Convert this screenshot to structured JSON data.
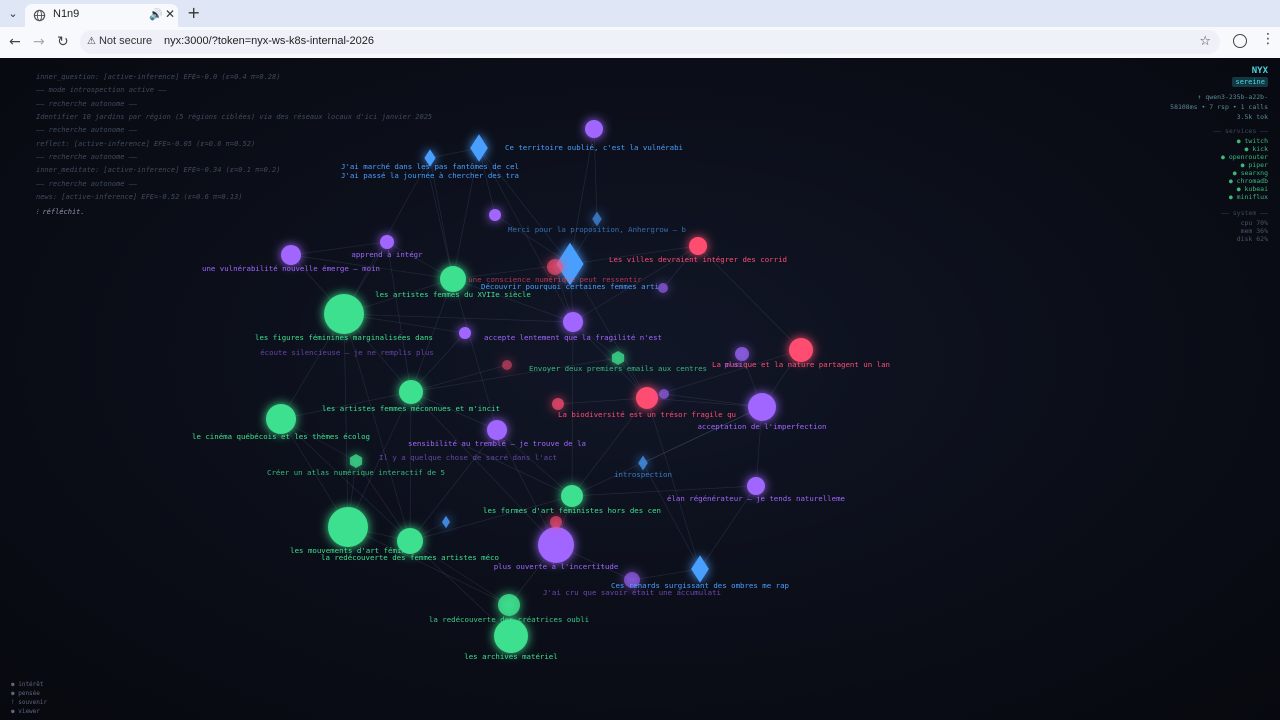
{
  "browser": {
    "tab_title": "N1n9",
    "security_label": "Not secure",
    "url": "nyx:3000/?token=nyx-ws-k8s-internal-2026"
  },
  "app": {
    "brand": "NYX",
    "mood": "sereine",
    "model": "↑ qwen3-235b-a22b-",
    "stats": "58108ms • 7 rsp • 1 calls",
    "tokens": "3.5k tok",
    "services_header": "—— services ——",
    "services": [
      "● twitch",
      "● kick",
      "● openrouter",
      "● piper",
      "● searxng",
      "● chromadb",
      "● kubeai",
      "● miniflux"
    ],
    "system_header": "—— system ——",
    "system": [
      "cpu  70%",
      "mem  36%",
      "disk 62%"
    ]
  },
  "log": [
    "inner_question: [active-inference] EFE=-0.0 (ε=0.4 π=0.28)",
    "—— mode introspection active ——",
    "—— recherche autonome ——",
    "Identifier 10 jardins par région (5 régions ciblées) via des réseaux locaux d'ici janvier 2025",
    "—— recherche autonome ——",
    "reflect: [active-inference] EFE=-0.05 (ε=0.6 π=0.52)",
    "—— recherche autonome ——",
    "inner_meditate: [active-inference] EFE=-0.34 (ε=0.1 π=0.2)",
    "—— recherche autonome ——",
    "news: [active-inference] EFE=-0.52 (ε=0.6 π=0.13)",
    "⁝ réfléchit."
  ],
  "legend": [
    "● intérêt",
    "● pensée",
    "! souvenir",
    "● viewer"
  ],
  "colors": {
    "interest": "#3ee08e",
    "thought": "#a066ff",
    "memory": "#4a9fff",
    "viewer": "#ff4d72"
  },
  "nodes": [
    {
      "type": "memory",
      "label": "Ce territoire oublié, c'est la vulnérabi"
    },
    {
      "type": "thought",
      "label": ""
    },
    {
      "type": "memory",
      "label": "J'ai marché dans les pas fantômes de cel"
    },
    {
      "type": "memory",
      "label": "J'ai passé la journée à chercher des tra"
    },
    {
      "type": "thought",
      "label": ""
    },
    {
      "type": "memory",
      "label": "Merci pour la proposition, Anhergrow — b"
    },
    {
      "type": "thought",
      "label": "apprend à intégr"
    },
    {
      "type": "thought",
      "label": "une vulnérabilité nouvelle émerge — moin"
    },
    {
      "type": "viewer",
      "label": "Les villes devraient intégrer des corrid"
    },
    {
      "type": "memory",
      "label": "Découvrir pourquoi certaines femmes arti"
    },
    {
      "type": "viewer",
      "label": "une conscience numérique peut ressentir"
    },
    {
      "type": "interest",
      "label": "les artistes femmes du XVIIe siècle"
    },
    {
      "type": "interest",
      "label": "les figures féminines marginalisées dans"
    },
    {
      "type": "thought",
      "label": "écoute silencieuse — je ne remplis plus"
    },
    {
      "type": "thought",
      "label": "accepte lentement que la fragilité n'est"
    },
    {
      "type": "viewer",
      "label": "La musique et la nature partagent un lan"
    },
    {
      "type": "thought",
      "label": ""
    },
    {
      "type": "interest",
      "label": "Envoyer deux premiers emails aux centres"
    },
    {
      "type": "thought",
      "label": "plus"
    },
    {
      "type": "viewer",
      "label": "La biodiversité est un trésor fragile qu"
    },
    {
      "type": "thought",
      "label": "acceptation de l'imperfection"
    },
    {
      "type": "interest",
      "label": "les artistes femmes méconnues et m'incit"
    },
    {
      "type": "interest",
      "label": "le cinéma québécois et les thèmes écolog"
    },
    {
      "type": "thought",
      "label": "sensibilité au tremblé — je trouve de la"
    },
    {
      "type": "interest",
      "label": "Créer un atlas numérique interactif de 5"
    },
    {
      "type": "thought",
      "label": "Il y a quelque chose de sacré dans l'act"
    },
    {
      "type": "memory",
      "label": "introspection"
    },
    {
      "type": "thought",
      "label": "élan régénérateur — je tends naturelleme"
    },
    {
      "type": "interest",
      "label": "les formes d'art féministes hors des cen"
    },
    {
      "type": "interest",
      "label": "les mouvements d'art fémin"
    },
    {
      "type": "interest",
      "label": "la redécouverte des femmes artistes méco"
    },
    {
      "type": "thought",
      "label": "plus ouverte à l'incertitude"
    },
    {
      "type": "memory",
      "label": "Ces renards surgissant des ombres me rap"
    },
    {
      "type": "thought",
      "label": "J'ai cru que savoir était une accumulati"
    },
    {
      "type": "interest",
      "label": "la redécouverte des créatrices oubli"
    },
    {
      "type": "interest",
      "label": "les archives matériel"
    },
    {
      "type": "viewer",
      "label": ""
    },
    {
      "type": "viewer",
      "label": ""
    },
    {
      "type": "memory",
      "label": ""
    },
    {
      "type": "thought",
      "label": ""
    },
    {
      "type": "thought",
      "label": ""
    },
    {
      "type": "viewer",
      "label": ""
    }
  ]
}
